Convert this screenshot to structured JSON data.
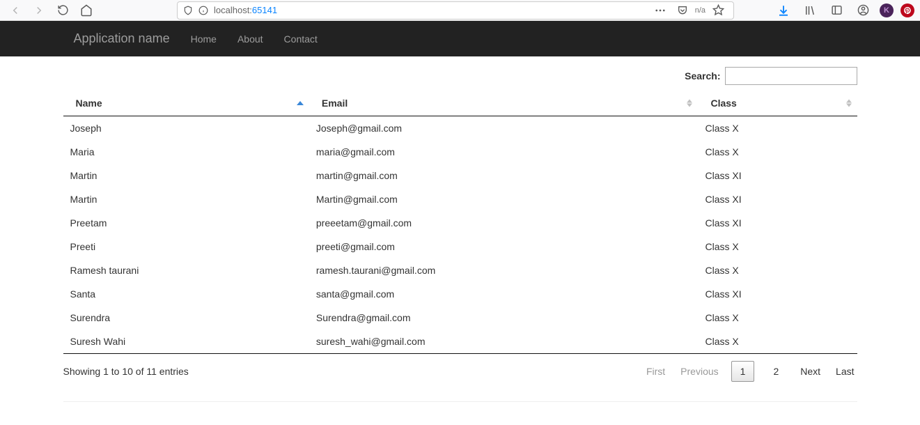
{
  "browser": {
    "url_prefix": "localhost:",
    "url_port": "65141",
    "tracking_label": "n/a"
  },
  "navbar": {
    "brand": "Application name",
    "items": [
      "Home",
      "About",
      "Contact"
    ]
  },
  "search": {
    "label": "Search:",
    "value": ""
  },
  "table": {
    "headers": [
      "Name",
      "Email",
      "Class"
    ],
    "rows": [
      {
        "name": "Joseph",
        "email": "Joseph@gmail.com",
        "class": "Class X"
      },
      {
        "name": "Maria",
        "email": "maria@gmail.com",
        "class": "Class X"
      },
      {
        "name": "Martin",
        "email": "martin@gmail.com",
        "class": "Class XI"
      },
      {
        "name": "Martin",
        "email": "Martin@gmail.com",
        "class": "Class XI"
      },
      {
        "name": "Preetam",
        "email": "preeetam@gmail.com",
        "class": "Class XI"
      },
      {
        "name": "Preeti",
        "email": "preeti@gmail.com",
        "class": "Class X"
      },
      {
        "name": "Ramesh taurani",
        "email": "ramesh.taurani@gmail.com",
        "class": "Class X"
      },
      {
        "name": "Santa",
        "email": "santa@gmail.com",
        "class": "Class XI"
      },
      {
        "name": "Surendra",
        "email": "Surendra@gmail.com",
        "class": "Class X"
      },
      {
        "name": "Suresh Wahi",
        "email": "suresh_wahi@gmail.com",
        "class": "Class X"
      }
    ]
  },
  "pagination": {
    "info": "Showing 1 to 10 of 11 entries",
    "first": "First",
    "previous": "Previous",
    "next": "Next",
    "last": "Last",
    "pages": [
      "1",
      "2"
    ],
    "current": "1"
  }
}
